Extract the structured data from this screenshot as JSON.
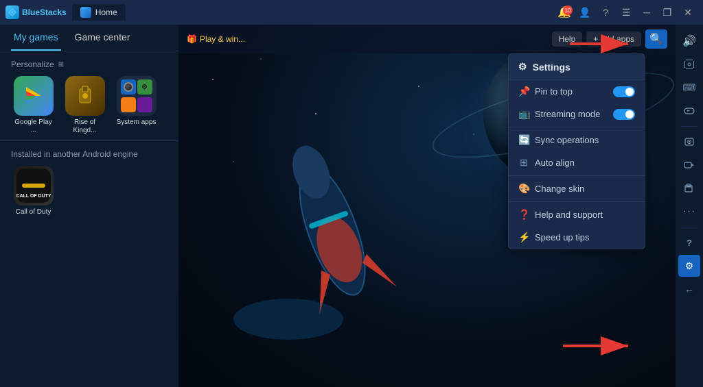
{
  "app": {
    "name": "BlueStacks",
    "tab_label": "Home"
  },
  "titlebar": {
    "notification_count": "10",
    "buttons": {
      "minimize": "─",
      "maximize": "❐",
      "close": "✕",
      "back": "❮"
    }
  },
  "nav": {
    "tabs": [
      {
        "id": "my-games",
        "label": "My games",
        "active": true
      },
      {
        "id": "game-center",
        "label": "Game center",
        "active": false
      }
    ]
  },
  "sidebar": {
    "personalize_label": "Personalize",
    "games": [
      {
        "id": "google-play",
        "label": "Google Play ..."
      },
      {
        "id": "rise-of-kingdoms",
        "label": "Rise of Kingd..."
      },
      {
        "id": "system-apps",
        "label": "System apps"
      }
    ],
    "installed_section": {
      "title": "Installed in another Android engine",
      "games": [
        {
          "id": "call-of-duty",
          "label": "Call of Duty"
        }
      ]
    }
  },
  "topbar": {
    "promo_icon": "🎁",
    "promo_text": "Play & win...",
    "help_label": "Help",
    "add_apps_label": "+ add apps"
  },
  "dropdown": {
    "header": "Settings",
    "items": [
      {
        "id": "pin-to-top",
        "label": "Pin to top",
        "icon": "📌",
        "has_toggle": true,
        "toggle_on": true
      },
      {
        "id": "streaming-mode",
        "label": "Streaming mode",
        "icon": "📺",
        "has_toggle": true,
        "toggle_on": true
      },
      {
        "id": "separator1",
        "type": "separator"
      },
      {
        "id": "sync-operations",
        "label": "Sync operations",
        "icon": "🔄",
        "has_toggle": false
      },
      {
        "id": "auto-align",
        "label": "Auto align",
        "icon": "⊞",
        "has_toggle": false
      },
      {
        "id": "separator2",
        "type": "separator"
      },
      {
        "id": "change-skin",
        "label": "Change skin",
        "icon": "🎨",
        "has_toggle": false
      },
      {
        "id": "separator3",
        "type": "separator"
      },
      {
        "id": "help-support",
        "label": "Help and support",
        "icon": "❓",
        "has_toggle": false
      },
      {
        "id": "speed-up-tips",
        "label": "Speed up tips",
        "icon": "⚡",
        "has_toggle": false
      }
    ]
  },
  "right_sidebar": {
    "buttons": [
      {
        "id": "volume",
        "icon": "🔊"
      },
      {
        "id": "cursor",
        "icon": "⊹"
      },
      {
        "id": "keyboard",
        "icon": "⌨"
      },
      {
        "id": "gamepad",
        "icon": "⊞"
      },
      {
        "id": "screen-capture",
        "icon": "◉"
      },
      {
        "id": "video",
        "icon": "▶"
      },
      {
        "id": "files",
        "icon": "📁"
      },
      {
        "id": "more",
        "icon": "⋯"
      },
      {
        "id": "help",
        "icon": "?"
      },
      {
        "id": "settings",
        "icon": "⚙"
      },
      {
        "id": "back",
        "icon": "←"
      }
    ]
  }
}
